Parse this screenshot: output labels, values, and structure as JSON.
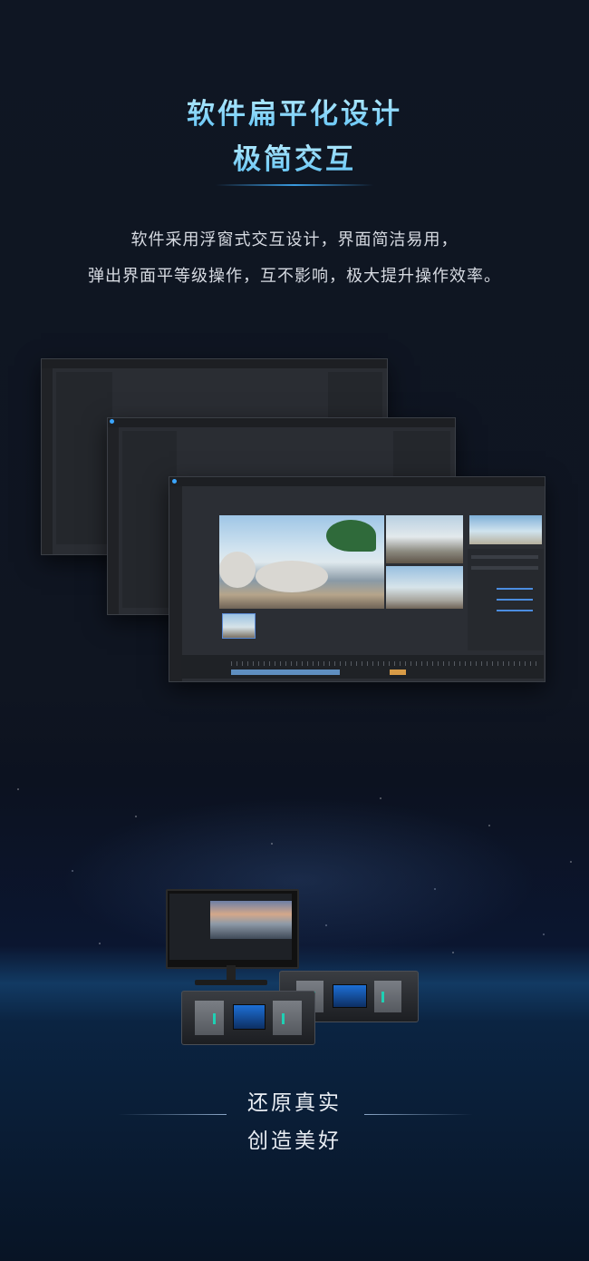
{
  "heading": {
    "line1": "软件扁平化设计",
    "line2": "极简交互"
  },
  "description": {
    "line1": "软件采用浮窗式交互设计，界面简洁易用，",
    "line2": "弹出界面平等级操作，互不影响，极大提升操作效率。"
  },
  "slogan": {
    "line1": "还原真实",
    "line2": "创造美好"
  },
  "colors": {
    "accent_blue": "#5fc3f5",
    "background": "#0f1623"
  },
  "icons": [
    "app-window-icon",
    "server-icon",
    "monitor-icon"
  ]
}
